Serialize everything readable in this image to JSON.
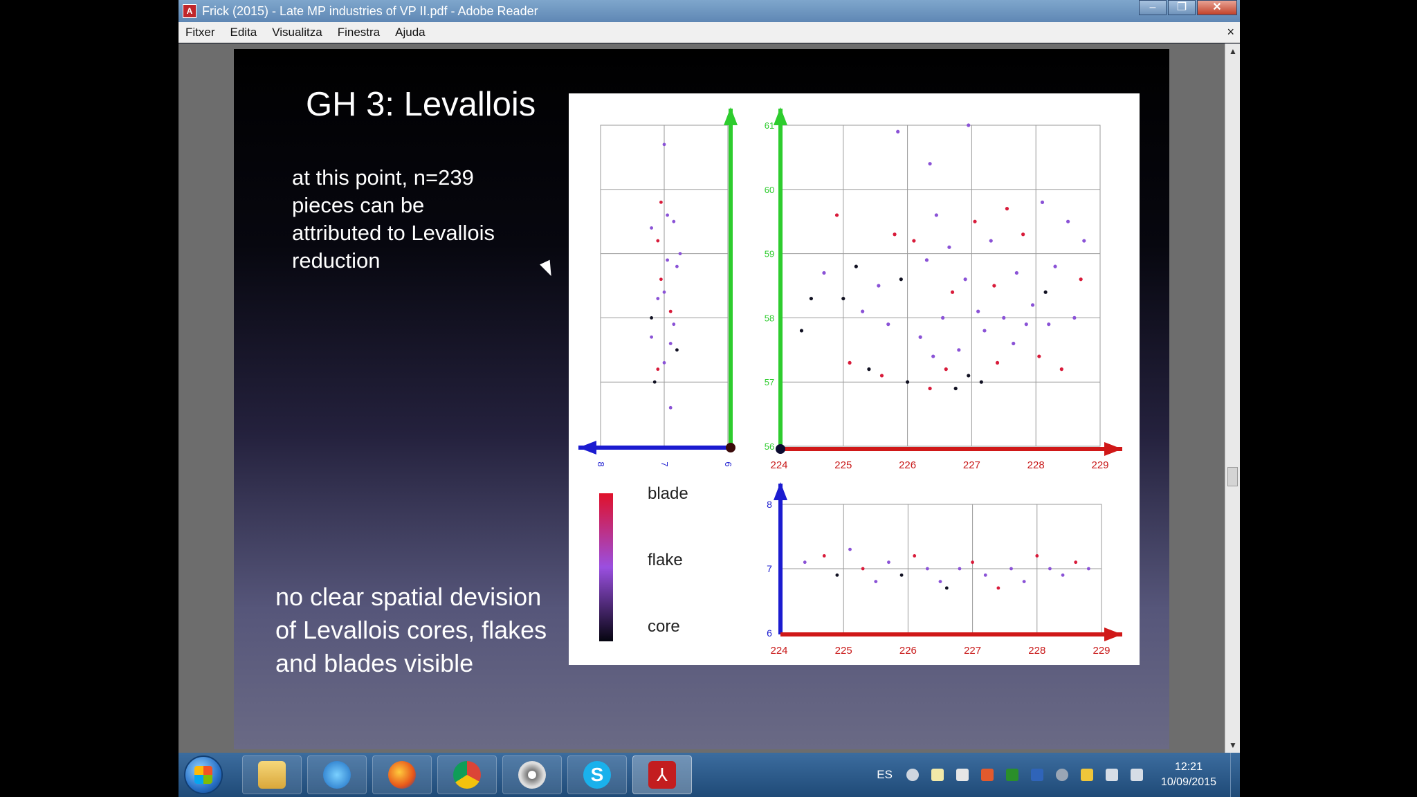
{
  "window": {
    "title": "Frick (2015) - Late MP industries of VP II.pdf - Adobe Reader",
    "app_icon": "acrobat-icon",
    "buttons": [
      "minimize",
      "restore",
      "close"
    ]
  },
  "menubar": {
    "items": [
      "Fitxer",
      "Edita",
      "Visualitza",
      "Finestra",
      "Ajuda"
    ],
    "close_doc": "×"
  },
  "slide": {
    "title": "GH 3: Levallois",
    "text1": "at this point, n=239 pieces can be attributed to Levallois reduction",
    "text2": "no clear spatial devision  of Levallois cores, flakes and blades visible"
  },
  "chart_data": [
    {
      "type": "scatter",
      "panel": "plan view (x vs y)",
      "x_ticks": [
        "224",
        "225",
        "226",
        "227",
        "228",
        "229"
      ],
      "y_ticks": [
        "56",
        "57",
        "58",
        "59",
        "60",
        "61"
      ],
      "xlim": [
        224,
        229
      ],
      "ylim": [
        56,
        61
      ],
      "grid": true,
      "color_scale": "blade-flake-core",
      "points": [
        [
          224.35,
          57.8,
          "core"
        ],
        [
          224.5,
          58.3,
          "core"
        ],
        [
          224.7,
          58.7,
          "flake"
        ],
        [
          224.9,
          59.6,
          "blade"
        ],
        [
          225.0,
          58.3,
          "core"
        ],
        [
          225.1,
          57.3,
          "blade"
        ],
        [
          225.2,
          58.8,
          "core"
        ],
        [
          225.3,
          58.1,
          "flake"
        ],
        [
          225.4,
          57.2,
          "core"
        ],
        [
          225.55,
          58.5,
          "flake"
        ],
        [
          225.6,
          57.1,
          "blade"
        ],
        [
          225.7,
          57.9,
          "flake"
        ],
        [
          225.8,
          59.3,
          "blade"
        ],
        [
          225.9,
          58.6,
          "core"
        ],
        [
          226.0,
          57.0,
          "core"
        ],
        [
          226.1,
          59.2,
          "blade"
        ],
        [
          226.2,
          57.7,
          "flake"
        ],
        [
          226.3,
          58.9,
          "flake"
        ],
        [
          226.35,
          56.9,
          "blade"
        ],
        [
          226.4,
          57.4,
          "flake"
        ],
        [
          226.45,
          59.6,
          "flake"
        ],
        [
          226.55,
          58.0,
          "flake"
        ],
        [
          226.6,
          57.2,
          "blade"
        ],
        [
          226.65,
          59.1,
          "flake"
        ],
        [
          226.7,
          58.4,
          "blade"
        ],
        [
          226.75,
          56.9,
          "core"
        ],
        [
          226.8,
          57.5,
          "flake"
        ],
        [
          226.9,
          58.6,
          "flake"
        ],
        [
          226.95,
          57.1,
          "core"
        ],
        [
          227.05,
          59.5,
          "blade"
        ],
        [
          227.1,
          58.1,
          "flake"
        ],
        [
          227.15,
          57.0,
          "core"
        ],
        [
          227.2,
          57.8,
          "flake"
        ],
        [
          227.3,
          59.2,
          "flake"
        ],
        [
          227.35,
          58.5,
          "blade"
        ],
        [
          227.4,
          57.3,
          "blade"
        ],
        [
          227.5,
          58.0,
          "flake"
        ],
        [
          227.55,
          59.7,
          "blade"
        ],
        [
          227.65,
          57.6,
          "flake"
        ],
        [
          227.7,
          58.7,
          "flake"
        ],
        [
          227.8,
          59.3,
          "blade"
        ],
        [
          227.85,
          57.9,
          "flake"
        ],
        [
          227.95,
          58.2,
          "flake"
        ],
        [
          228.05,
          57.4,
          "blade"
        ],
        [
          228.1,
          59.8,
          "flake"
        ],
        [
          228.15,
          58.4,
          "core"
        ],
        [
          228.2,
          57.9,
          "flake"
        ],
        [
          228.3,
          58.8,
          "flake"
        ],
        [
          228.4,
          57.2,
          "blade"
        ],
        [
          228.5,
          59.5,
          "flake"
        ],
        [
          228.6,
          58.0,
          "flake"
        ],
        [
          228.7,
          58.6,
          "blade"
        ],
        [
          228.75,
          59.2,
          "flake"
        ],
        [
          225.85,
          60.9,
          "flake"
        ],
        [
          226.35,
          60.4,
          "flake"
        ],
        [
          226.95,
          61.0,
          "flake"
        ]
      ]
    },
    {
      "type": "scatter",
      "panel": "profile (z vs y)",
      "x_ticks": [
        "8",
        "7",
        "6"
      ],
      "xlim": [
        6,
        8
      ],
      "ylim": [
        56,
        61
      ],
      "grid": true,
      "points": [
        [
          7.1,
          57.2,
          "blade"
        ],
        [
          6.9,
          57.6,
          "flake"
        ],
        [
          7.2,
          58.0,
          "core"
        ],
        [
          7.0,
          58.4,
          "flake"
        ],
        [
          6.8,
          58.8,
          "flake"
        ],
        [
          7.1,
          59.2,
          "blade"
        ],
        [
          6.95,
          59.6,
          "flake"
        ],
        [
          7.15,
          57.0,
          "core"
        ],
        [
          6.85,
          57.9,
          "flake"
        ],
        [
          7.05,
          58.6,
          "blade"
        ],
        [
          6.75,
          59.0,
          "flake"
        ],
        [
          7.2,
          59.4,
          "flake"
        ],
        [
          6.9,
          58.1,
          "blade"
        ],
        [
          7.0,
          57.3,
          "flake"
        ],
        [
          6.8,
          57.5,
          "core"
        ],
        [
          7.1,
          58.3,
          "flake"
        ],
        [
          6.95,
          58.9,
          "flake"
        ],
        [
          7.05,
          59.8,
          "blade"
        ],
        [
          6.85,
          59.5,
          "flake"
        ],
        [
          7.2,
          57.7,
          "flake"
        ],
        [
          6.9,
          56.6,
          "flake"
        ],
        [
          7.0,
          60.7,
          "flake"
        ]
      ]
    },
    {
      "type": "scatter",
      "panel": "section (x vs z)",
      "x_ticks": [
        "224",
        "225",
        "226",
        "227",
        "228",
        "229"
      ],
      "y_ticks": [
        "6",
        "7",
        "8"
      ],
      "xlim": [
        224,
        229
      ],
      "ylim": [
        6,
        8
      ],
      "grid": true,
      "points": [
        [
          224.4,
          7.1,
          "flake"
        ],
        [
          224.7,
          7.2,
          "blade"
        ],
        [
          224.9,
          6.9,
          "core"
        ],
        [
          225.1,
          7.3,
          "flake"
        ],
        [
          225.3,
          7.0,
          "blade"
        ],
        [
          225.5,
          6.8,
          "flake"
        ],
        [
          225.7,
          7.1,
          "flake"
        ],
        [
          225.9,
          6.9,
          "core"
        ],
        [
          226.1,
          7.2,
          "blade"
        ],
        [
          226.3,
          7.0,
          "flake"
        ],
        [
          226.5,
          6.8,
          "flake"
        ],
        [
          226.6,
          6.7,
          "core"
        ],
        [
          226.8,
          7.0,
          "flake"
        ],
        [
          227.0,
          7.1,
          "blade"
        ],
        [
          227.2,
          6.9,
          "flake"
        ],
        [
          227.4,
          6.7,
          "blade"
        ],
        [
          227.6,
          7.0,
          "flake"
        ],
        [
          227.8,
          6.8,
          "flake"
        ],
        [
          228.0,
          7.2,
          "blade"
        ],
        [
          228.2,
          7.0,
          "flake"
        ],
        [
          228.4,
          6.9,
          "flake"
        ],
        [
          228.6,
          7.1,
          "blade"
        ],
        [
          228.8,
          7.0,
          "flake"
        ]
      ]
    },
    {
      "type": "legend",
      "labels": [
        "blade",
        "flake",
        "core"
      ],
      "colors": [
        "#e0112a",
        "#9a4fe0",
        "#050510"
      ]
    }
  ],
  "taskbar": {
    "pinned": [
      "explorer-icon",
      "internet-explorer-icon",
      "firefox-icon",
      "chrome-icon",
      "camera-icon",
      "skype-icon",
      "adobe-reader-icon"
    ],
    "lang": "ES",
    "time": "12:21",
    "date": "10/09/2015"
  }
}
